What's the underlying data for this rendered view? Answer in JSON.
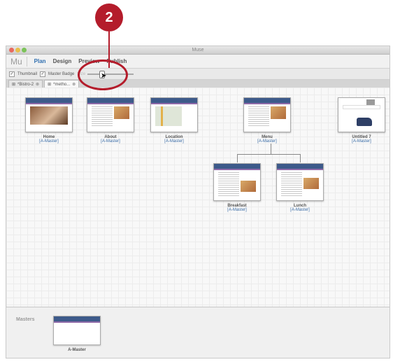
{
  "callout": {
    "number": "2"
  },
  "window": {
    "title": "Muse"
  },
  "menubar": {
    "logo": "Mu",
    "tabs": [
      {
        "label": "Plan",
        "active": true
      },
      {
        "label": "Design"
      },
      {
        "label": "Preview"
      },
      {
        "label": "Publish"
      }
    ]
  },
  "toolbar": {
    "thumbnail_label": "Thumbnail",
    "master_badge_label": "Master Badge",
    "size_label": "Size"
  },
  "doc_tabs": [
    {
      "label": "*Bistro-2"
    },
    {
      "label": "*metho..."
    }
  ],
  "pages": [
    {
      "name": "Home",
      "master": "[A-Master]"
    },
    {
      "name": "About",
      "master": "[A-Master]"
    },
    {
      "name": "Location",
      "master": "[A-Master]"
    },
    {
      "name": "Menu",
      "master": "[A-Master]"
    },
    {
      "name": "Untitled 7",
      "master": "[A-Master]"
    },
    {
      "name": "Breakfast",
      "master": "[A-Master]"
    },
    {
      "name": "Lunch",
      "master": "[A-Master]"
    }
  ],
  "masters": {
    "label": "Masters",
    "items": [
      {
        "name": "A-Master"
      }
    ]
  },
  "colors": {
    "accent_blue": "#2f6fb0",
    "callout_red": "#b41c2b",
    "header_navy": "#3d5a8a"
  }
}
